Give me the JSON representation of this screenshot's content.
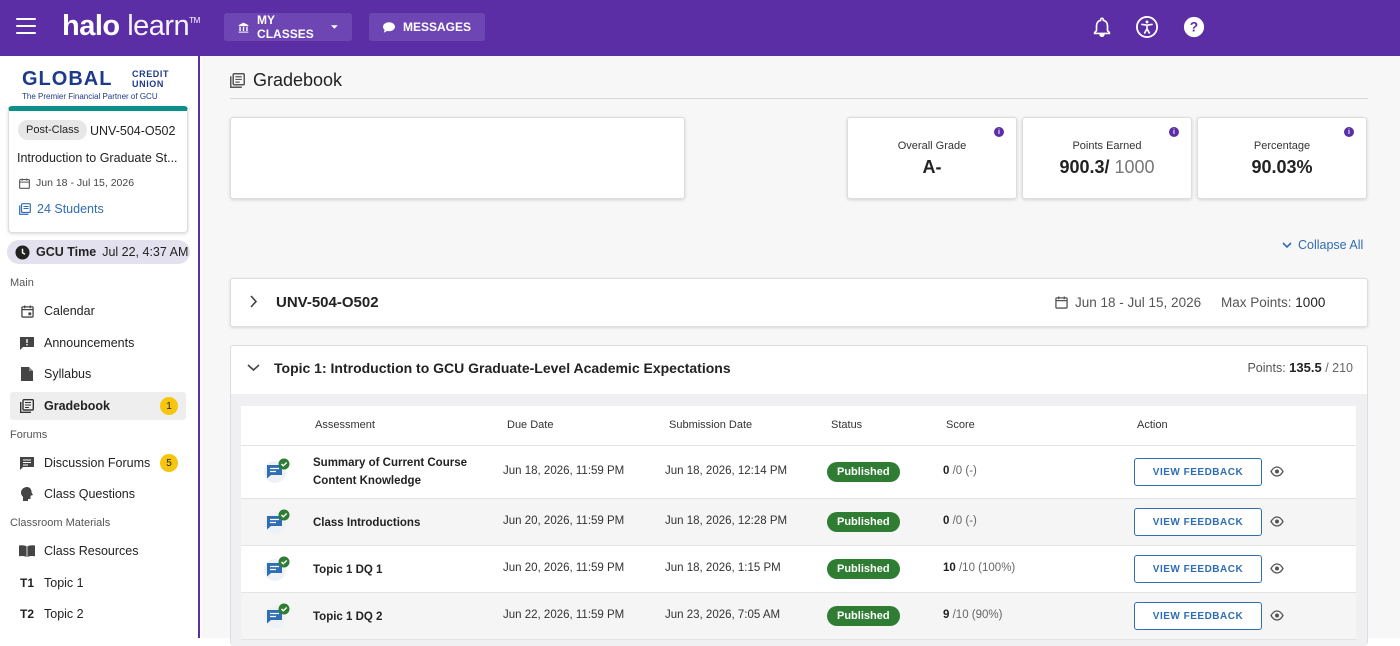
{
  "header": {
    "logo_halo": "halo",
    "logo_learn": "learn",
    "logo_tm": "TM",
    "my_classes_label": "MY CLASSES",
    "messages_label": "MESSAGES",
    "icons": [
      "bell-icon",
      "accessibility-icon",
      "help-icon"
    ],
    "brand_color": "#5b2ea6"
  },
  "sidebar": {
    "org_name_big": "GLOBAL",
    "org_name_small_1": "CREDIT",
    "org_name_small_2": "UNION",
    "org_tagline": "The Premier Financial Partner of GCU",
    "course_card": {
      "badge": "Post-Class",
      "code": "UNV-504-O502",
      "name": "Introduction to Graduate St...",
      "dates": "Jun 18 - Jul 15, 2026",
      "students": "24 Students"
    },
    "gcu_time_label": "GCU Time",
    "gcu_time_value": "Jul 22, 4:37 AM",
    "sections": {
      "main": "Main",
      "forums": "Forums",
      "materials": "Classroom Materials"
    },
    "items": [
      {
        "label": "Calendar"
      },
      {
        "label": "Announcements"
      },
      {
        "label": "Syllabus"
      },
      {
        "label": "Gradebook",
        "badge": "1"
      },
      {
        "label": "Discussion Forums",
        "badge": "5"
      },
      {
        "label": "Class Questions"
      },
      {
        "label": "Class Resources"
      },
      {
        "label": "Topic 1",
        "tag": "T1"
      },
      {
        "label": "Topic 2",
        "tag": "T2"
      }
    ]
  },
  "main": {
    "title": "Gradebook",
    "stats": [
      {
        "label": "Overall Grade",
        "value": "A-"
      },
      {
        "label": "Points Earned",
        "value": "900.3/",
        "value_dim": " 1000"
      },
      {
        "label": "Percentage",
        "value": "90.03%"
      }
    ],
    "collapse_all": "Collapse All",
    "course_row": {
      "name": "UNV-504-O502",
      "dates": "Jun 18 - Jul 15, 2026",
      "max_points_label": "Max Points:",
      "max_points_value": "1000"
    },
    "topic": {
      "name": "Topic 1: Introduction to GCU Graduate-Level Academic Expectations",
      "points_label": "Points:",
      "points_earned": "135.5",
      "points_total": " / 210"
    },
    "table": {
      "headers": [
        "Assessment",
        "Due Date",
        "Submission Date",
        "Status",
        "Score",
        "Action"
      ],
      "rows": [
        {
          "name_1": "Summary of Current Course",
          "name_2": "Content Knowledge",
          "due": "Jun 18, 2026, 11:59 PM",
          "submitted": "Jun 18, 2026, 12:14 PM",
          "status": "Published",
          "score": "0",
          "score_rest": " /0 (-)",
          "action": "VIEW FEEDBACK"
        },
        {
          "name_1": "Class Introductions",
          "name_2": "",
          "due": "Jun 20, 2026, 11:59 PM",
          "submitted": "Jun 18, 2026, 12:28 PM",
          "status": "Published",
          "score": "0",
          "score_rest": " /0 (-)",
          "action": "VIEW FEEDBACK"
        },
        {
          "name_1": "Topic 1 DQ 1",
          "name_2": "",
          "due": "Jun 20, 2026, 11:59 PM",
          "submitted": "Jun 18, 2026, 1:15 PM",
          "status": "Published",
          "score": "10",
          "score_rest": " /10 (100%)",
          "action": "VIEW FEEDBACK"
        },
        {
          "name_1": "Topic 1 DQ 2",
          "name_2": "",
          "due": "Jun 22, 2026, 11:59 PM",
          "submitted": "Jun 23, 2026, 7:05 AM",
          "status": "Published",
          "score": "9",
          "score_rest": " /10 (90%)",
          "action": "VIEW FEEDBACK"
        }
      ]
    }
  }
}
